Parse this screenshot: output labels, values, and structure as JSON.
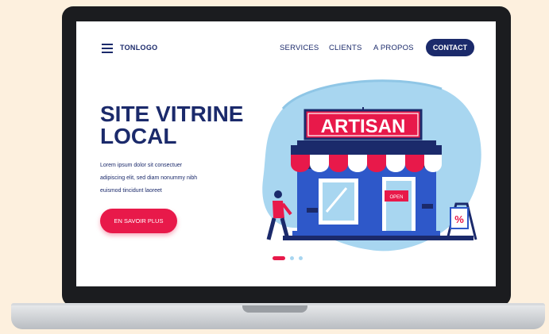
{
  "nav": {
    "logo": "TONLOGO",
    "items": [
      "SERVICES",
      "CLIENTS",
      "A PROPOS"
    ],
    "contact": "CONTACT"
  },
  "hero": {
    "title_line1": "SITE VITRINE",
    "title_line2": "LOCAL",
    "text_line1": "Lorem ipsum dolor sit consectuer",
    "text_line2": "adipiscing elit, sed diam nonummy nibh",
    "text_line3": "euismod tincidunt laoreet",
    "cta": "EN SAVOIR PLUS"
  },
  "illustration": {
    "sign": "ARTISAN",
    "open_tag": "OPEN",
    "percent": "%"
  },
  "carousel": {
    "active_index": 0,
    "count": 3
  },
  "colors": {
    "primary": "#1b2a6b",
    "accent": "#e8194a",
    "shop_blue": "#2e58c9",
    "blob": "#a8d6f0",
    "background": "#fdf0de"
  }
}
